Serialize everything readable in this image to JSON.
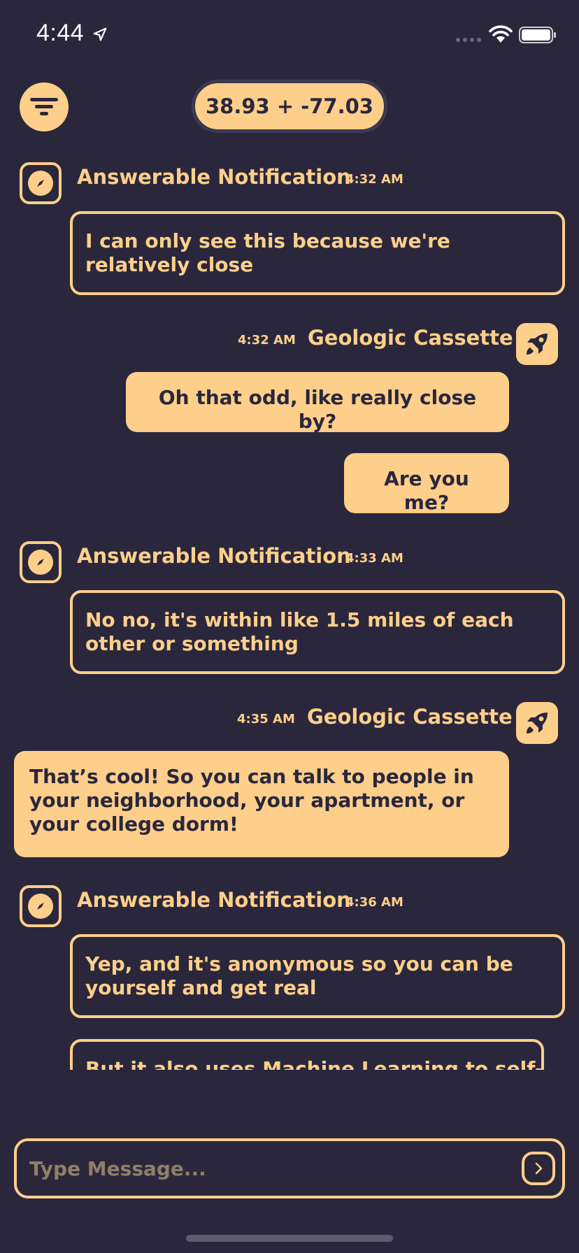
{
  "status_bar": {
    "time": "4:44"
  },
  "header": {
    "coordinates": "38.93 + -77.03"
  },
  "messages": [
    {
      "sender": "Answerable Notification",
      "time": "4:32 AM",
      "bubbles": [
        "I can only see this because we're relatively close"
      ]
    },
    {
      "sender": "Geologic Cassette",
      "time": "4:32 AM",
      "bubbles": [
        "Oh that odd, like really close by?",
        "Are you me?"
      ]
    },
    {
      "sender": "Answerable Notification",
      "time": "4:33 AM",
      "bubbles": [
        "No no, it's within like 1.5 miles of each other  or something"
      ]
    },
    {
      "sender": "Geologic Cassette",
      "time": "4:35 AM",
      "bubbles": [
        "That’s cool! So you can talk to people in your neighborhood, your apartment, or your college dorm!"
      ]
    },
    {
      "sender": "Answerable Notification",
      "time": "4:36 AM",
      "bubbles": [
        "Yep, and it's anonymous so you can be yourself and get real",
        "But it also uses Machine Learning to self-"
      ]
    }
  ],
  "composer": {
    "placeholder": "Type Message..."
  },
  "colors": {
    "background": "#2a273d",
    "accent": "#fecf8a",
    "placeholder": "#8f7f67"
  },
  "icons": {
    "filter": "filter-icon",
    "left_avatar": "compass-icon",
    "right_avatar": "rocket-icon",
    "send": "chevron-right-icon"
  }
}
